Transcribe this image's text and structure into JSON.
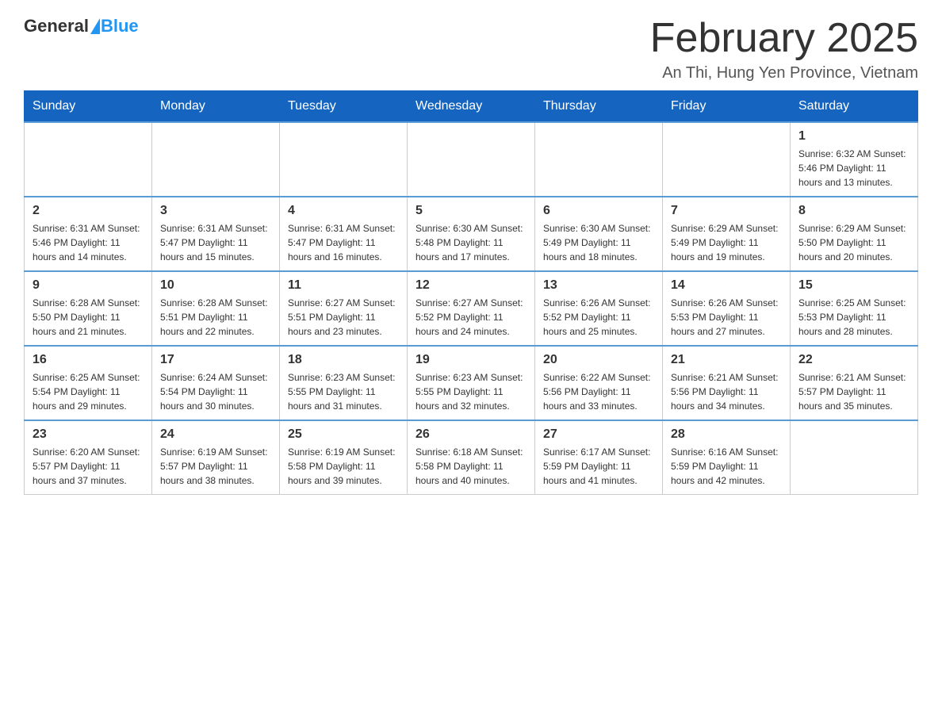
{
  "header": {
    "logo_general": "General",
    "logo_blue": "Blue",
    "month_title": "February 2025",
    "location": "An Thi, Hung Yen Province, Vietnam"
  },
  "weekdays": [
    "Sunday",
    "Monday",
    "Tuesday",
    "Wednesday",
    "Thursday",
    "Friday",
    "Saturday"
  ],
  "weeks": [
    [
      {
        "day": "",
        "info": ""
      },
      {
        "day": "",
        "info": ""
      },
      {
        "day": "",
        "info": ""
      },
      {
        "day": "",
        "info": ""
      },
      {
        "day": "",
        "info": ""
      },
      {
        "day": "",
        "info": ""
      },
      {
        "day": "1",
        "info": "Sunrise: 6:32 AM\nSunset: 5:46 PM\nDaylight: 11 hours and 13 minutes."
      }
    ],
    [
      {
        "day": "2",
        "info": "Sunrise: 6:31 AM\nSunset: 5:46 PM\nDaylight: 11 hours and 14 minutes."
      },
      {
        "day": "3",
        "info": "Sunrise: 6:31 AM\nSunset: 5:47 PM\nDaylight: 11 hours and 15 minutes."
      },
      {
        "day": "4",
        "info": "Sunrise: 6:31 AM\nSunset: 5:47 PM\nDaylight: 11 hours and 16 minutes."
      },
      {
        "day": "5",
        "info": "Sunrise: 6:30 AM\nSunset: 5:48 PM\nDaylight: 11 hours and 17 minutes."
      },
      {
        "day": "6",
        "info": "Sunrise: 6:30 AM\nSunset: 5:49 PM\nDaylight: 11 hours and 18 minutes."
      },
      {
        "day": "7",
        "info": "Sunrise: 6:29 AM\nSunset: 5:49 PM\nDaylight: 11 hours and 19 minutes."
      },
      {
        "day": "8",
        "info": "Sunrise: 6:29 AM\nSunset: 5:50 PM\nDaylight: 11 hours and 20 minutes."
      }
    ],
    [
      {
        "day": "9",
        "info": "Sunrise: 6:28 AM\nSunset: 5:50 PM\nDaylight: 11 hours and 21 minutes."
      },
      {
        "day": "10",
        "info": "Sunrise: 6:28 AM\nSunset: 5:51 PM\nDaylight: 11 hours and 22 minutes."
      },
      {
        "day": "11",
        "info": "Sunrise: 6:27 AM\nSunset: 5:51 PM\nDaylight: 11 hours and 23 minutes."
      },
      {
        "day": "12",
        "info": "Sunrise: 6:27 AM\nSunset: 5:52 PM\nDaylight: 11 hours and 24 minutes."
      },
      {
        "day": "13",
        "info": "Sunrise: 6:26 AM\nSunset: 5:52 PM\nDaylight: 11 hours and 25 minutes."
      },
      {
        "day": "14",
        "info": "Sunrise: 6:26 AM\nSunset: 5:53 PM\nDaylight: 11 hours and 27 minutes."
      },
      {
        "day": "15",
        "info": "Sunrise: 6:25 AM\nSunset: 5:53 PM\nDaylight: 11 hours and 28 minutes."
      }
    ],
    [
      {
        "day": "16",
        "info": "Sunrise: 6:25 AM\nSunset: 5:54 PM\nDaylight: 11 hours and 29 minutes."
      },
      {
        "day": "17",
        "info": "Sunrise: 6:24 AM\nSunset: 5:54 PM\nDaylight: 11 hours and 30 minutes."
      },
      {
        "day": "18",
        "info": "Sunrise: 6:23 AM\nSunset: 5:55 PM\nDaylight: 11 hours and 31 minutes."
      },
      {
        "day": "19",
        "info": "Sunrise: 6:23 AM\nSunset: 5:55 PM\nDaylight: 11 hours and 32 minutes."
      },
      {
        "day": "20",
        "info": "Sunrise: 6:22 AM\nSunset: 5:56 PM\nDaylight: 11 hours and 33 minutes."
      },
      {
        "day": "21",
        "info": "Sunrise: 6:21 AM\nSunset: 5:56 PM\nDaylight: 11 hours and 34 minutes."
      },
      {
        "day": "22",
        "info": "Sunrise: 6:21 AM\nSunset: 5:57 PM\nDaylight: 11 hours and 35 minutes."
      }
    ],
    [
      {
        "day": "23",
        "info": "Sunrise: 6:20 AM\nSunset: 5:57 PM\nDaylight: 11 hours and 37 minutes."
      },
      {
        "day": "24",
        "info": "Sunrise: 6:19 AM\nSunset: 5:57 PM\nDaylight: 11 hours and 38 minutes."
      },
      {
        "day": "25",
        "info": "Sunrise: 6:19 AM\nSunset: 5:58 PM\nDaylight: 11 hours and 39 minutes."
      },
      {
        "day": "26",
        "info": "Sunrise: 6:18 AM\nSunset: 5:58 PM\nDaylight: 11 hours and 40 minutes."
      },
      {
        "day": "27",
        "info": "Sunrise: 6:17 AM\nSunset: 5:59 PM\nDaylight: 11 hours and 41 minutes."
      },
      {
        "day": "28",
        "info": "Sunrise: 6:16 AM\nSunset: 5:59 PM\nDaylight: 11 hours and 42 minutes."
      },
      {
        "day": "",
        "info": ""
      }
    ]
  ]
}
